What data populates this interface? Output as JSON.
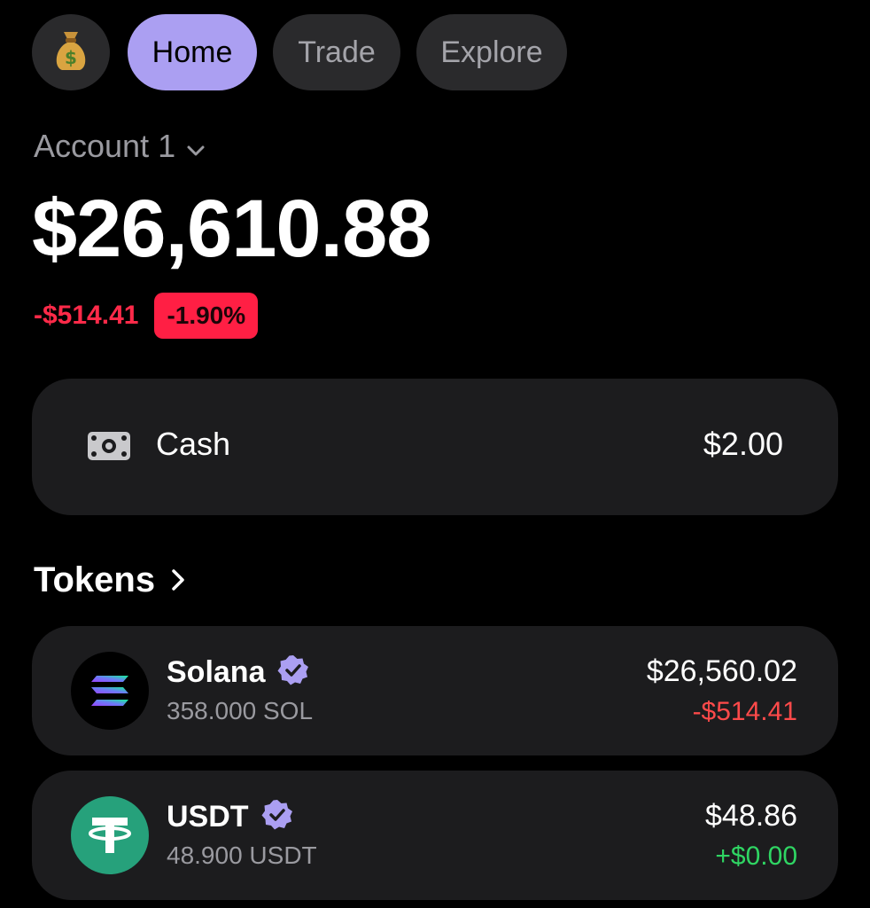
{
  "nav": {
    "avatar_icon": "money-bag-icon",
    "tabs": [
      {
        "label": "Home",
        "active": true
      },
      {
        "label": "Trade",
        "active": false
      },
      {
        "label": "Explore",
        "active": false
      }
    ]
  },
  "account": {
    "name": "Account 1",
    "balance": "$26,610.88",
    "change_amount": "-$514.41",
    "change_percent": "-1.90%"
  },
  "cash": {
    "label": "Cash",
    "value": "$2.00",
    "icon": "banknote-icon"
  },
  "tokens": {
    "title": "Tokens",
    "items": [
      {
        "name": "Solana",
        "amount": "358.000 SOL",
        "value": "$26,560.02",
        "change": "-$514.41",
        "verified": true,
        "icon": "solana-logo-icon"
      },
      {
        "name": "USDT",
        "amount": "48.900 USDT",
        "value": "$48.86",
        "change": "+$0.00",
        "verified": true,
        "icon": "tether-logo-icon"
      }
    ]
  },
  "colors": {
    "accent": "#ab9ff2",
    "negative": "#ff2a49",
    "positive": "#2fd563",
    "card": "#1c1c1e",
    "usdt_green": "#26a17b"
  }
}
